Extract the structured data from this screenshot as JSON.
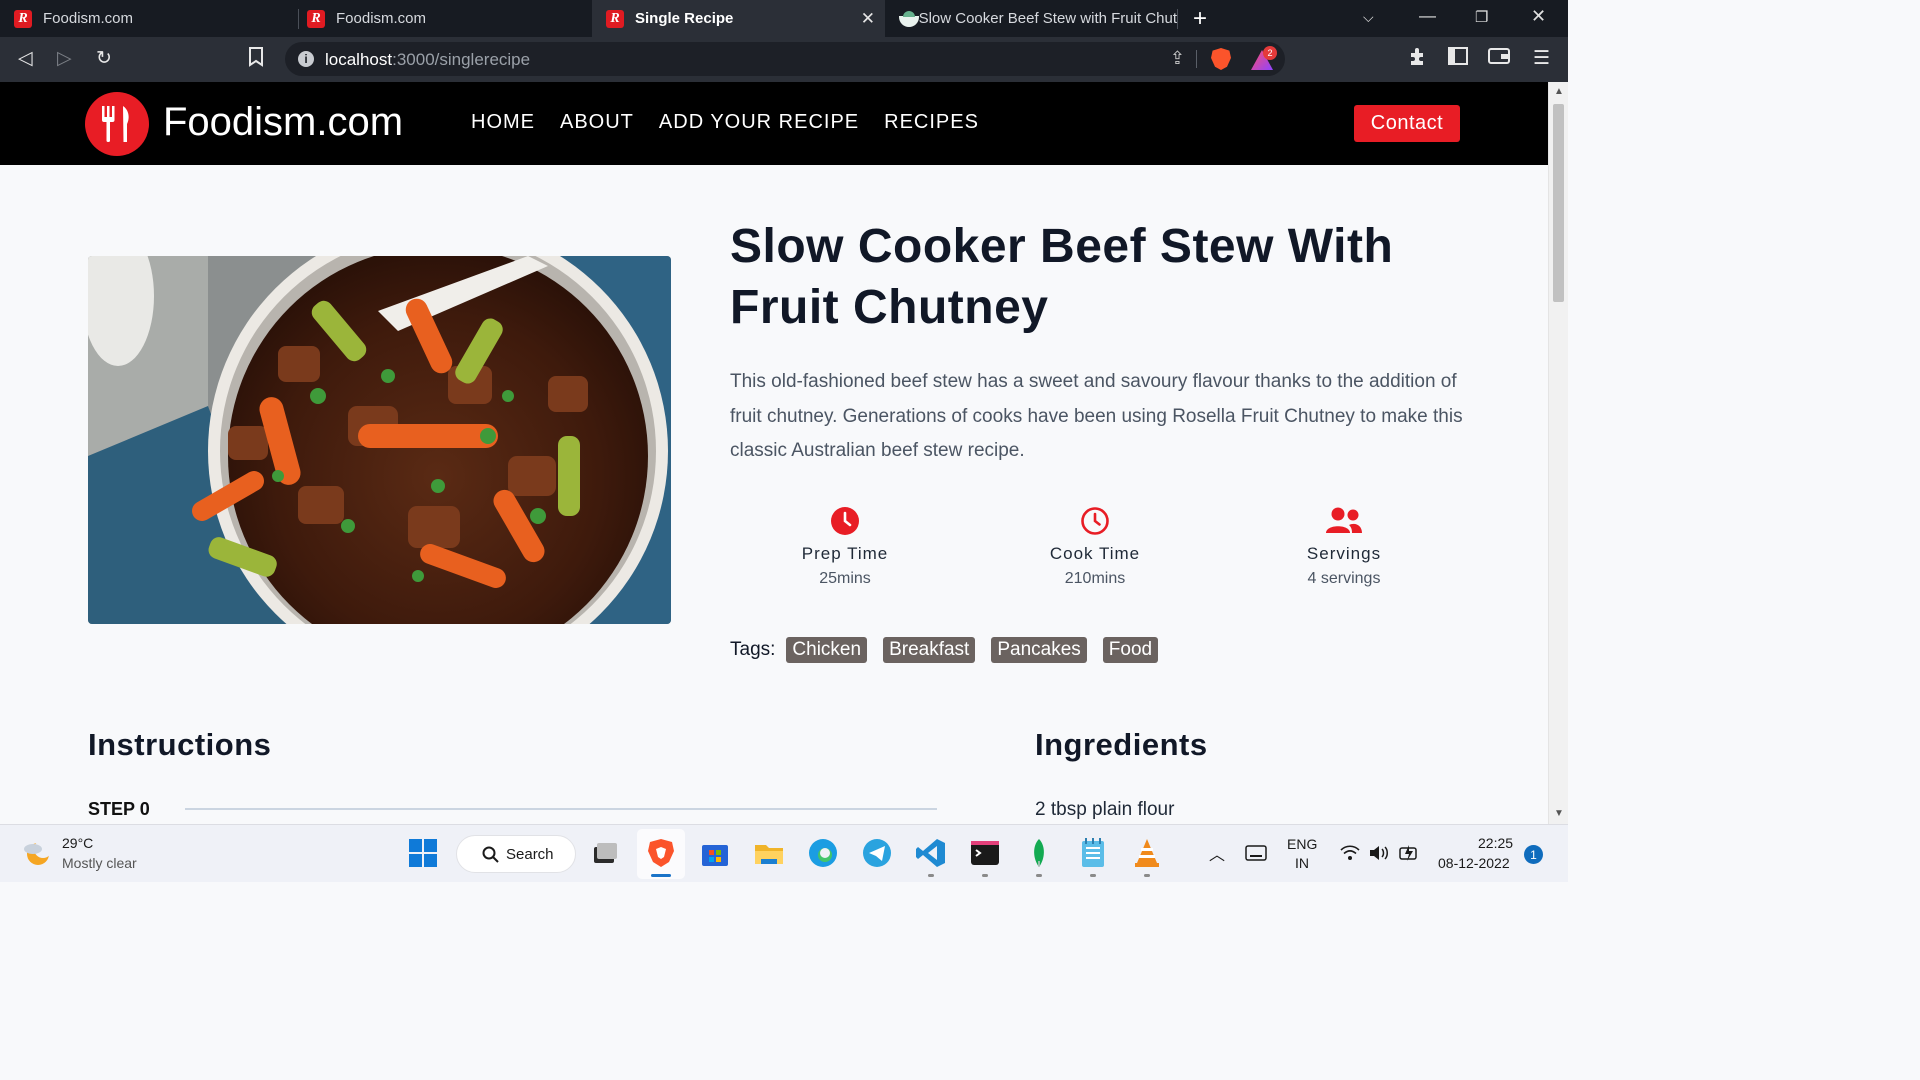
{
  "browser": {
    "tabs": [
      {
        "title": "Foodism.com",
        "active": false
      },
      {
        "title": "Foodism.com",
        "active": false
      },
      {
        "title": "Single Recipe",
        "active": true
      },
      {
        "title": "Slow Cooker Beef Stew with Fruit Chut",
        "active": false
      }
    ],
    "url_host": "localhost",
    "url_path": ":3000/singlerecipe",
    "rewards_count": "2"
  },
  "site": {
    "brand": "Foodism.com",
    "nav": [
      "HOME",
      "ABOUT",
      "ADD YOUR RECIPE",
      "RECIPES"
    ],
    "contact_label": "Contact",
    "accent_color": "#e81d25"
  },
  "recipe": {
    "title": "Slow Cooker Beef Stew With Fruit Chutney",
    "description": "This old-fashioned beef stew has a sweet and savoury flavour thanks to the addition of fruit chutney. Generations of cooks have been using Rosella Fruit Chutney to make this classic Australian beef stew recipe.",
    "stats": [
      {
        "label": "Prep Time",
        "value": "25mins",
        "icon": "clock-filled-icon"
      },
      {
        "label": "Cook Time",
        "value": "210mins",
        "icon": "clock-outline-icon"
      },
      {
        "label": "Servings",
        "value": "4 servings",
        "icon": "users-icon"
      }
    ],
    "tags_label": "Tags:",
    "tags": [
      "Chicken",
      "Breakfast",
      "Pancakes",
      "Food"
    ],
    "instructions_title": "Instructions",
    "first_step_label": "STEP 0",
    "ingredients_title": "Ingredients",
    "first_ingredient": "2 tbsp plain flour"
  },
  "taskbar": {
    "weather_temp": "29°C",
    "weather_condition": "Mostly clear",
    "search_label": "Search",
    "language_line1": "ENG",
    "language_line2": "IN",
    "time": "22:25",
    "date": "08-12-2022",
    "notification_count": "1"
  }
}
